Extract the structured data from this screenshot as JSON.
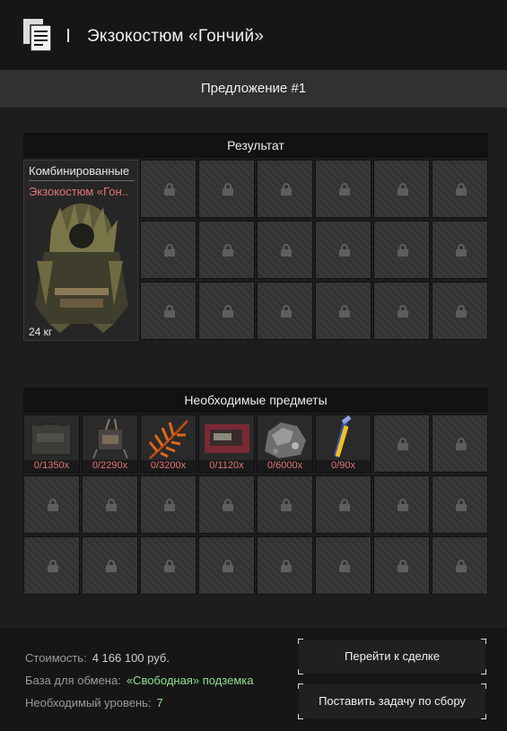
{
  "header": {
    "title": "Экзокостюм «Гончий»",
    "icon": "document-icon"
  },
  "offer": {
    "label": "Предложение #1"
  },
  "result": {
    "section_title": "Результат",
    "category": "Комбинированные",
    "item_name": "Экзокостюм «Гон..",
    "weight": "24 кг",
    "locked_slots": 18
  },
  "required": {
    "section_title": "Необходимые предметы",
    "items": [
      {
        "icon": "battery-block-icon",
        "qty": "0/1350x"
      },
      {
        "icon": "electronic-part-icon",
        "qty": "0/2290x"
      },
      {
        "icon": "fern-leaf-icon",
        "qty": "0/3200x"
      },
      {
        "icon": "circuit-board-icon",
        "qty": "0/1120x"
      },
      {
        "icon": "mineral-rock-icon",
        "qty": "0/6000x"
      },
      {
        "icon": "vial-icon",
        "qty": "0/90x"
      }
    ],
    "locked_slots": 18
  },
  "footer": {
    "cost_label": "Стоимость:",
    "cost_value": "4 166 100 руб.",
    "base_label": "База для обмена:",
    "base_value": "«Свободная» подземка",
    "level_label": "Необходимый уровень:",
    "level_value": "7",
    "go_to_deal": "Перейти к сделке",
    "set_task": "Поставить задачу по сбору"
  },
  "colors": {
    "item_name": "#e37575",
    "qty_text": "#e37575",
    "highlight_green": "#8ee08e"
  }
}
